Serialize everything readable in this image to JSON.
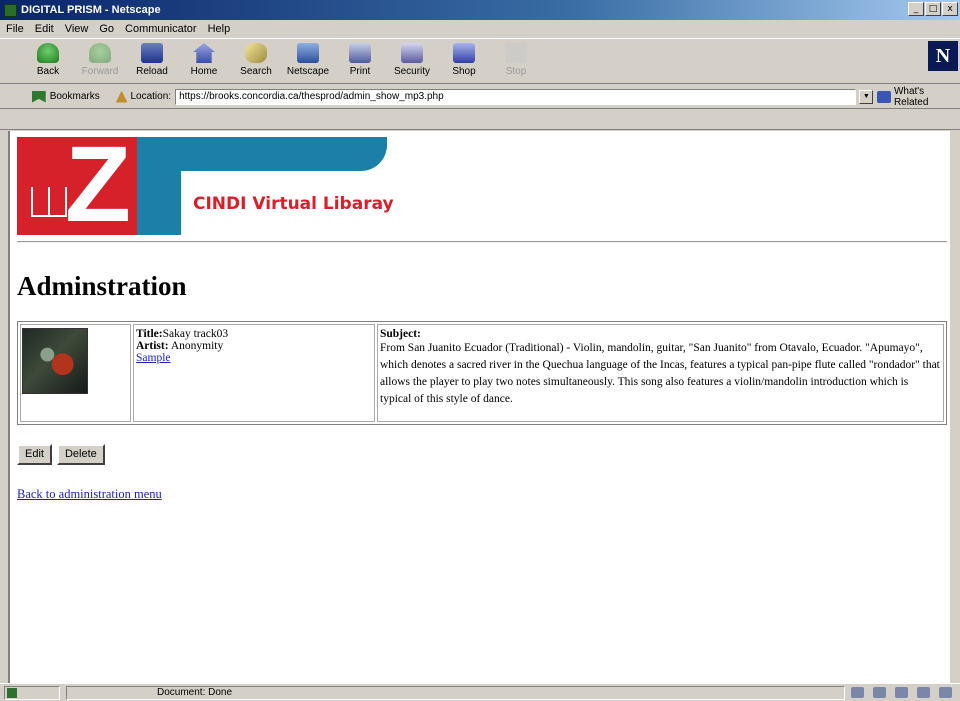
{
  "window": {
    "title": "DIGITAL PRISM - Netscape",
    "min": "_",
    "max": "□",
    "close": "x"
  },
  "menu": [
    "File",
    "Edit",
    "View",
    "Go",
    "Communicator",
    "Help"
  ],
  "toolbar": {
    "buttons": [
      {
        "label": "Back",
        "icon": "back-arrow-icon"
      },
      {
        "label": "Forward",
        "icon": "forward-arrow-icon",
        "disabled": true
      },
      {
        "label": "Reload",
        "icon": "reload-icon"
      },
      {
        "label": "Home",
        "icon": "home-icon"
      },
      {
        "label": "Search",
        "icon": "search-icon"
      },
      {
        "label": "Netscape",
        "icon": "netscape-icon"
      },
      {
        "label": "Print",
        "icon": "print-icon"
      },
      {
        "label": "Security",
        "icon": "security-icon"
      },
      {
        "label": "Shop",
        "icon": "shop-icon"
      },
      {
        "label": "Stop",
        "icon": "stop-icon",
        "disabled": true
      }
    ],
    "logo": "N"
  },
  "location": {
    "bookmarks_label": "Bookmarks",
    "location_label": "Location:",
    "url": "https://brooks.concordia.ca/thesprod/admin_show_mp3.php",
    "related_label": "What's Related"
  },
  "banner": {
    "text": "CINDI Virtual Libaray",
    "letter": "Z"
  },
  "page": {
    "title": "Adminstration",
    "item": {
      "title_label": "Title:",
      "title_value": "Sakay track03",
      "artist_label": "Artist:",
      "artist_value": "Anonymity",
      "sample_link": "Sample",
      "subject_label": "Subject:",
      "subject_text": "From San Juanito Ecuador (Traditional) - Violin, mandolin, guitar, \"San Juanito\" from Otavalo, Ecuador. \"Apumayo\", which denotes a sacred river in the Quechua language of the Incas, features a typical pan-pipe flute called \"rondador\" that allows the player to play two notes simultaneously. This song also features a violin/mandolin introduction which is typical of this style of dance."
    },
    "edit_button": "Edit",
    "delete_button": "Delete",
    "back_link": "Back to administration menu"
  },
  "status": {
    "text": "Document: Done"
  }
}
